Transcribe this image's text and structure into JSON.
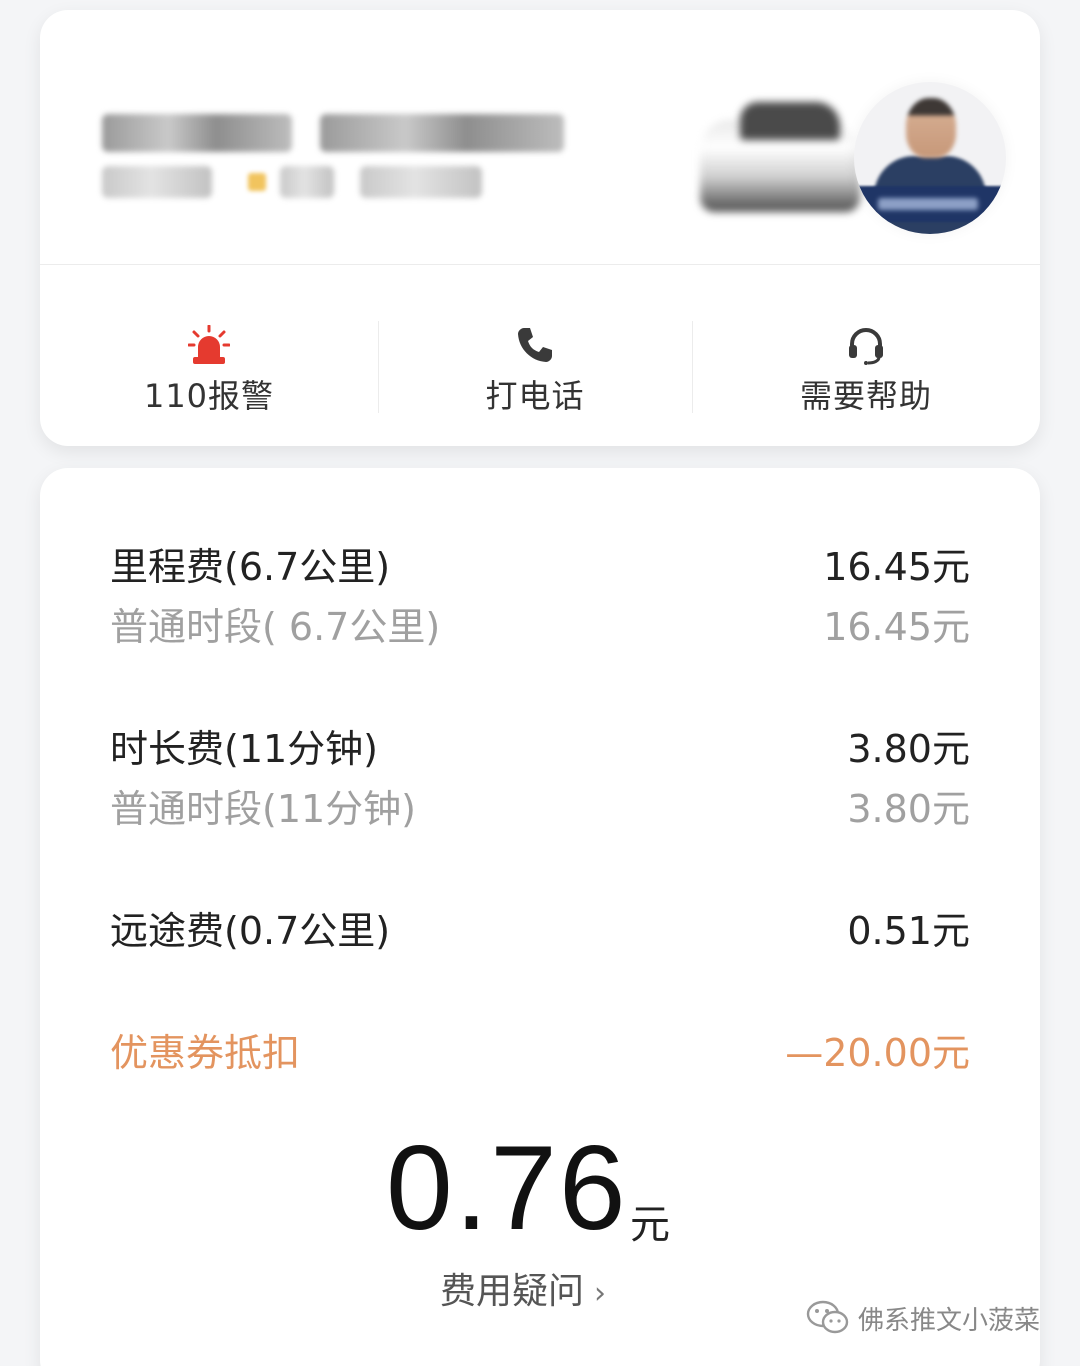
{
  "driver": {
    "plate_model": "京 A***** 比亚迪e5 · 白色",
    "name_rating_orders": "司机 ★ 5.0 8**单",
    "rating": "5.0"
  },
  "actions": [
    {
      "label": "110报警",
      "icon": "alarm-siren-icon"
    },
    {
      "label": "打电话",
      "icon": "phone-icon"
    },
    {
      "label": "需要帮助",
      "icon": "headset-icon"
    }
  ],
  "fees": {
    "mileage": {
      "name": "里程费(6.7公里)",
      "amount": "16.45元"
    },
    "mileage_normal": {
      "name": "普通时段( 6.7公里)",
      "amount": "16.45元"
    },
    "duration": {
      "name": "时长费(11分钟)",
      "amount": "3.80元"
    },
    "duration_normal": {
      "name": "普通时段(11分钟)",
      "amount": "3.80元"
    },
    "long_distance": {
      "name": "远途费(0.7公里)",
      "amount": "0.51元"
    },
    "coupon": {
      "name": "优惠券抵扣",
      "amount": "—20.00元"
    }
  },
  "total": {
    "amount": "0.76",
    "unit": "元"
  },
  "fee_question": {
    "label": "费用疑问",
    "chevron": "›"
  },
  "watermark": {
    "text": "佛系推文小菠菜"
  },
  "colors": {
    "alarm": "#e53a2f",
    "coupon": "#e3945f",
    "sub_text": "#a0a0a0"
  }
}
